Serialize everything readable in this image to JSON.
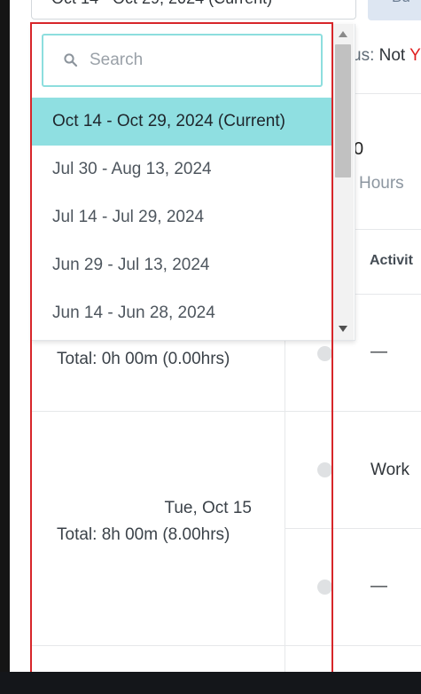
{
  "period_select": {
    "value": "Oct 14 - Oct 29, 2024 (Current)"
  },
  "top_button": {
    "label": "Bu"
  },
  "status": {
    "label": "us:",
    "value": "Not ",
    "value_red": "Y"
  },
  "summary": {
    "hours_value": "0",
    "hours_label": "Hours"
  },
  "table": {
    "activity_header": "Activit",
    "days": [
      {
        "date": "",
        "total": "Total: 0h 00m (0.00hrs)",
        "rows": [
          "—"
        ]
      },
      {
        "date": "Tue, Oct 15",
        "total": "Total: 8h 00m (8.00hrs)",
        "rows": [
          "Work",
          "—"
        ]
      }
    ]
  },
  "dropdown": {
    "search_placeholder": "Search",
    "options": [
      {
        "label": "Oct 14 - Oct 29, 2024 (Current)",
        "selected": true
      },
      {
        "label": "Jul 30 - Aug 13, 2024",
        "selected": false
      },
      {
        "label": "Jul 14 - Jul 29, 2024",
        "selected": false
      },
      {
        "label": "Jun 29 - Jul 13, 2024",
        "selected": false
      },
      {
        "label": "Jun 14 - Jun 28, 2024",
        "selected": false
      }
    ]
  },
  "icons": {
    "search": "search-icon",
    "scroll_up": "triangle-up-icon",
    "scroll_down": "triangle-down-icon"
  },
  "colors": {
    "selected_option": "#8fdfe1",
    "search_border": "#8ddede",
    "highlight_outline": "#d7262a",
    "status_red": "#e01f1f"
  }
}
